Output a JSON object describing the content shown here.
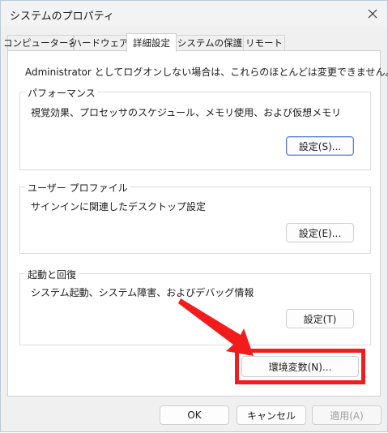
{
  "window": {
    "title": "システムのプロパティ"
  },
  "tabs": [
    {
      "label": "コンピューター名"
    },
    {
      "label": "ハードウェア"
    },
    {
      "label": "詳細設定"
    },
    {
      "label": "システムの保護"
    },
    {
      "label": "リモート"
    }
  ],
  "active_tab_index": 2,
  "advanced": {
    "admin_note": "Administrator としてログオンしない場合は、これらのほとんどは変更できません。",
    "performance": {
      "title": "パフォーマンス",
      "description": "視覚効果、プロセッサのスケジュール、メモリ使用、および仮想メモリ",
      "settings_label": "設定(S)..."
    },
    "user_profile": {
      "title": "ユーザー プロファイル",
      "description": "サインインに関連したデスクトップ設定",
      "settings_label": "設定(E)..."
    },
    "startup_recovery": {
      "title": "起動と回復",
      "description": "システム起動、システム障害、およびデバッグ情報",
      "settings_label": "設定(T)"
    },
    "env_vars_label": "環境変数(N)..."
  },
  "footer": {
    "ok_label": "OK",
    "cancel_label": "キャンセル",
    "apply_label": "適用(A)"
  },
  "colors": {
    "annotation_red": "#f21c1c",
    "focus_blue": "#5b7fcf"
  },
  "icons": {
    "close": "close-icon",
    "annotation": "red-arrow-icon"
  }
}
